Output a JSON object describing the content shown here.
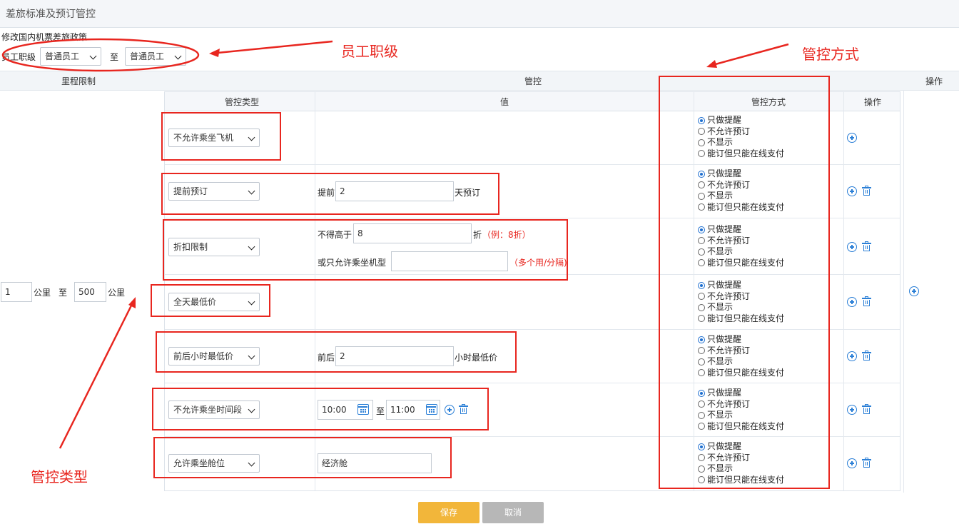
{
  "header": {
    "title": "差旅标准及预订管控"
  },
  "subtitle": "修改国内机票差旅政策",
  "rank": {
    "label": "员工职级",
    "from": "普通员工",
    "to_label": "至",
    "to": "普通员工"
  },
  "outer_headers": {
    "mileage": "里程限制",
    "control": "管控",
    "operation": "操作"
  },
  "inner_headers": {
    "type": "管控类型",
    "value": "值",
    "mode": "管控方式",
    "operation": "操作"
  },
  "mileage": {
    "from": "1",
    "unit1": "公里",
    "to_label": "至",
    "to": "500",
    "unit2": "公里"
  },
  "modes": [
    "只做提醒",
    "不允许预订",
    "不显示",
    "能订但只能在线支付"
  ],
  "rows": [
    {
      "type": "不允许乘坐飞机"
    },
    {
      "type": "提前预订",
      "prefix": "提前",
      "value": "2",
      "suffix": "天预订"
    },
    {
      "type": "折扣限制",
      "prefix": "不得高于",
      "value": "8",
      "suffix": "折",
      "hint": "（例：8折）",
      "prefix2": "或只允许乘坐机型",
      "value2": "",
      "hint2": "（多个用/分隔)"
    },
    {
      "type": "全天最低价"
    },
    {
      "type": "前后小时最低价",
      "prefix": "前后",
      "value": "2",
      "suffix": "小时最低价"
    },
    {
      "type": "不允许乘坐时间段",
      "time_from": "10:00",
      "to_label": "至",
      "time_to": "11:00"
    },
    {
      "type": "允许乘坐舱位",
      "value": "经济舱"
    }
  ],
  "annotations": {
    "rank": "员工职级",
    "mode": "管控方式",
    "type": "管控类型"
  },
  "buttons": {
    "save": "保存",
    "cancel": "取消"
  },
  "colors": {
    "annotation": "#e8261f",
    "accent": "#2b7fd6",
    "save": "#f2b63a",
    "cancel": "#b7b7b7"
  }
}
